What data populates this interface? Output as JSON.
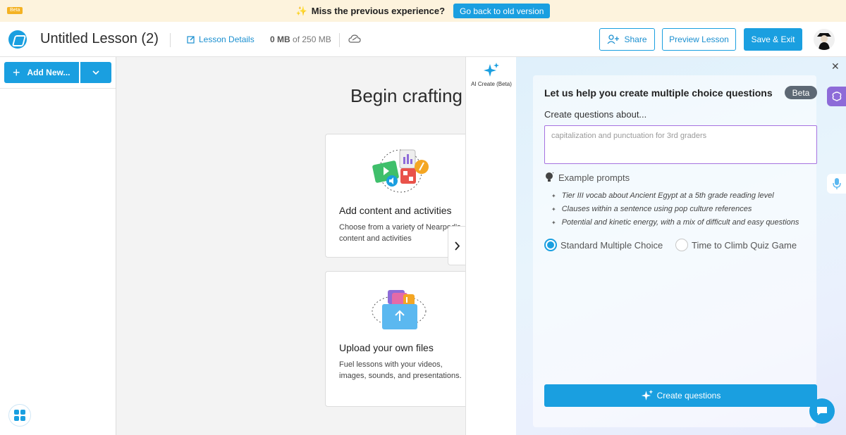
{
  "banner": {
    "tag": "Beta",
    "message": "Miss the previous experience?",
    "old_version_button": "Go back to old version"
  },
  "header": {
    "lesson_title": "Untitled Lesson (2)",
    "lesson_details": "Lesson Details",
    "storage_used": "0 MB",
    "storage_total": "of 250 MB",
    "share": "Share",
    "preview": "Preview Lesson",
    "save_exit": "Save & Exit"
  },
  "sidebar": {
    "add_new": "Add New..."
  },
  "main": {
    "heading": "Begin crafting",
    "cards": [
      {
        "title": "Add content and activities",
        "desc": "Choose from a variety of Nearpod's content and activities"
      },
      {
        "title": "Upload your own files",
        "desc": "Fuel lessons with your videos, images, sounds, and presentations."
      }
    ]
  },
  "rail": {
    "ai_create": "AI Create (Beta)"
  },
  "ai_panel": {
    "title": "Let us help you create multiple choice questions",
    "badge": "Beta",
    "subtitle": "Create questions about...",
    "input_value": "",
    "input_placeholder": "capitalization and punctuation for 3rd graders",
    "examples_heading": "Example prompts",
    "examples": [
      "Tier III vocab about Ancient Egypt at a 5th grade reading level",
      "Clauses within a sentence using pop culture references",
      "Potential and kinetic energy, with a mix of difficult and easy questions"
    ],
    "options": [
      {
        "label": "Standard Multiple Choice",
        "selected": true
      },
      {
        "label": "Time to Climb Quiz Game",
        "selected": false
      }
    ],
    "create_button": "Create questions"
  },
  "colors": {
    "accent": "#1a9fe0",
    "banner_bg": "#fdf3dd",
    "input_border": "#a672e0",
    "badge_bg": "#5d6874"
  }
}
